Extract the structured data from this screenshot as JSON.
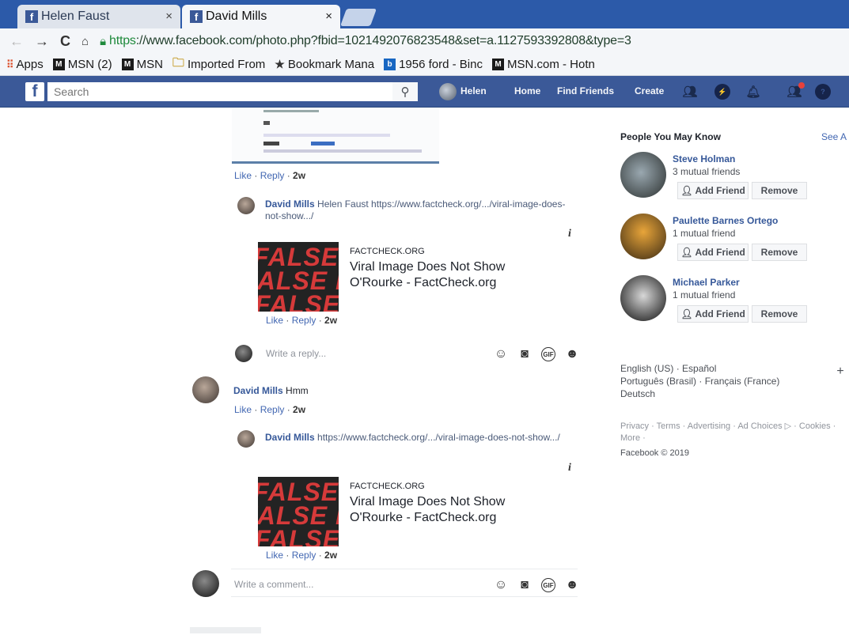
{
  "browser": {
    "tabs": [
      {
        "label": "Helen Faust",
        "active": false
      },
      {
        "label": "David Mills",
        "active": true
      }
    ],
    "address": {
      "scheme": "https",
      "rest": "://www.facebook.com/photo.php?fbid=1021492076823548&set=a.1127593392808&type=3"
    },
    "bookmarks": [
      {
        "label": "Apps",
        "icon": "apps-grid-icon"
      },
      {
        "label": "MSN (2)",
        "icon": "msn-icon"
      },
      {
        "label": "MSN",
        "icon": "msn-icon"
      },
      {
        "label": "Imported From",
        "icon": "folder-icon"
      },
      {
        "label": "Bookmark Mana",
        "icon": "star-icon"
      },
      {
        "label": "1956 ford - Binc",
        "icon": "bing-icon"
      },
      {
        "label": "MSN.com - Hotn",
        "icon": "msn-icon"
      }
    ]
  },
  "fb": {
    "logo": "f",
    "search_placeholder": "Search",
    "nav": {
      "user": "Helen",
      "home": "Home",
      "find_friends": "Find Friends",
      "create": "Create"
    }
  },
  "feed": {
    "photo_comment_actions": {
      "like": "Like",
      "reply": "Reply",
      "time": "2w"
    },
    "reply1": {
      "author": "David Mills",
      "text": " Helen Faust https://www.factcheck.org/.../viral-image-does-not-show.../",
      "card": {
        "source": "FACTCHECK.ORG",
        "title": "Viral Image Does Not Show O'Rourke - FactCheck.org",
        "thumb_text": "FALSE FALS"
      },
      "actions": {
        "like": "Like",
        "reply": "Reply",
        "time": "2w"
      }
    },
    "reply_placeholder": "Write a reply...",
    "comment2": {
      "author": "David Mills",
      "text": " Hmm",
      "actions": {
        "like": "Like",
        "reply": "Reply",
        "time": "2w"
      }
    },
    "reply2": {
      "author": "David Mills",
      "text": " https://www.factcheck.org/.../viral-image-does-not-show.../",
      "card": {
        "source": "FACTCHECK.ORG",
        "title": "Viral Image Does Not Show O'Rourke - FactCheck.org",
        "thumb_text": "FALSE FALS"
      },
      "actions": {
        "like": "Like",
        "reply": "Reply",
        "time": "2w"
      }
    },
    "comment_placeholder": "Write a comment..."
  },
  "sidebar": {
    "pymk_title": "People You May Know",
    "see_all": "See A",
    "people": [
      {
        "name": "Steve Holman",
        "mutual": "3 mutual friends",
        "add": "Add Friend",
        "remove": "Remove"
      },
      {
        "name": "Paulette Barnes Ortego",
        "mutual": "1 mutual friend",
        "add": "Add Friend",
        "remove": "Remove"
      },
      {
        "name": "Michael Parker",
        "mutual": "1 mutual friend",
        "add": "Add Friend",
        "remove": "Remove"
      }
    ],
    "languages": {
      "current": "English (US)",
      "others": [
        "Español",
        "Português (Brasil)",
        "Français (France)",
        "Deutsch"
      ]
    },
    "footer_links": "Privacy · Terms · Advertising · Ad Choices ▷ · Cookies · More ·",
    "copyright": "Facebook © 2019"
  }
}
